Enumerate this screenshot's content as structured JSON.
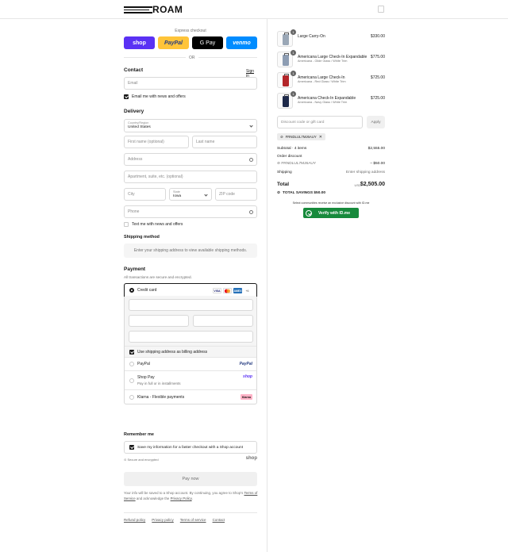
{
  "brand": {
    "name": "ROAM"
  },
  "express": {
    "label": "Express checkout",
    "buttons": [
      {
        "label": "shop",
        "bg": "#5a31f4",
        "fg": "#ffffff"
      },
      {
        "label": "PayPal",
        "bg": "#ffc439",
        "fg": "#253b80"
      },
      {
        "label": "G Pay",
        "bg": "#000000",
        "fg": "#ffffff"
      },
      {
        "label": "venmo",
        "bg": "#008cff",
        "fg": "#ffffff"
      }
    ],
    "or": "OR"
  },
  "contact": {
    "title": "Contact",
    "sign_in": "Sign in",
    "email_placeholder": "Email",
    "news_label": "Email me with news and offers"
  },
  "delivery": {
    "title": "Delivery",
    "country_label": "Country/Region",
    "country_value": "United States",
    "first_name": "First name (optional)",
    "last_name": "Last name",
    "address": "Address",
    "apartment": "Apartment, suite, etc. (optional)",
    "city": "City",
    "state_label": "State",
    "state_value": "Iowa",
    "zip": "ZIP code",
    "phone": "Phone",
    "text_label": "Text me with news and offers"
  },
  "shipping": {
    "title": "Shipping method",
    "message": "Enter your shipping address to view available shipping methods."
  },
  "payment": {
    "title": "Payment",
    "subtitle": "All transactions are secure and encrypted.",
    "credit_card": "Credit card",
    "card_logos": [
      "VISA",
      "MC",
      "AMEX",
      "+6"
    ],
    "billing_label": "Use shipping address as billing address",
    "paypal": "PayPal",
    "paypal_brand": "PayPal",
    "shop_pay": "Shop Pay",
    "shop_pay_sub": "Pay in full or in installments",
    "shop_brand": "shop",
    "klarna": "Klarna - Flexible payments",
    "klarna_brand": "Klarna"
  },
  "remember": {
    "title": "Remember me",
    "label": "Save my information for a faster checkout with a Shop account",
    "secure": "Secure and encrypted",
    "shop_mark": "shop"
  },
  "pay_now": "Pay now",
  "disclaimer": {
    "prefix": "Your info will be saved to a Shop account. By continuing, you agree to Shop's",
    "terms": "Terms of Service",
    "mid": "and acknowledge the",
    "privacy": "Privacy Policy",
    "suffix": "."
  },
  "footer": [
    "Refund policy",
    "Privacy policy",
    "Terms of service",
    "Contact"
  ],
  "order": {
    "items": [
      {
        "qty": "1",
        "name": "Large Carry-On",
        "variant": "",
        "price": "$330.00",
        "color": "#9aa7b6"
      },
      {
        "qty": "1",
        "name": "Americana Large Check-In Expandable",
        "variant": "Americana - Glide Glass / White Trim",
        "price": "$775.00",
        "color": "#8d9db3"
      },
      {
        "qty": "1",
        "name": "Americana Large Check-In",
        "variant": "Americana - Red Glass / White Trim",
        "price": "$725.00",
        "color": "#b3262a"
      },
      {
        "qty": "1",
        "name": "Americana Check-In Expandable",
        "variant": "Americana - Navy Glass / White Trim",
        "price": "$725.00",
        "color": "#1e2a4a"
      }
    ],
    "discount_placeholder": "Discount code or gift card",
    "apply": "Apply",
    "code_tag": "FRNDLUL7MJ6AUY",
    "subtotal_label": "Subtotal · 4 items",
    "subtotal_value": "$2,555.00",
    "order_discount_label": "Order discount",
    "discount_code": "FRNDLUL7MJ6AUY",
    "discount_value": "– $50.00",
    "shipping_label": "Shipping",
    "shipping_value": "Enter shipping address",
    "total_label": "Total",
    "total_currency": "USD",
    "total_value": "$2,505.00",
    "savings": "TOTAL SAVINGS  $50.00",
    "idme_text": "Select communities receive an exclusive discount with ID.me",
    "idme_button": "Verify with ID.me"
  }
}
